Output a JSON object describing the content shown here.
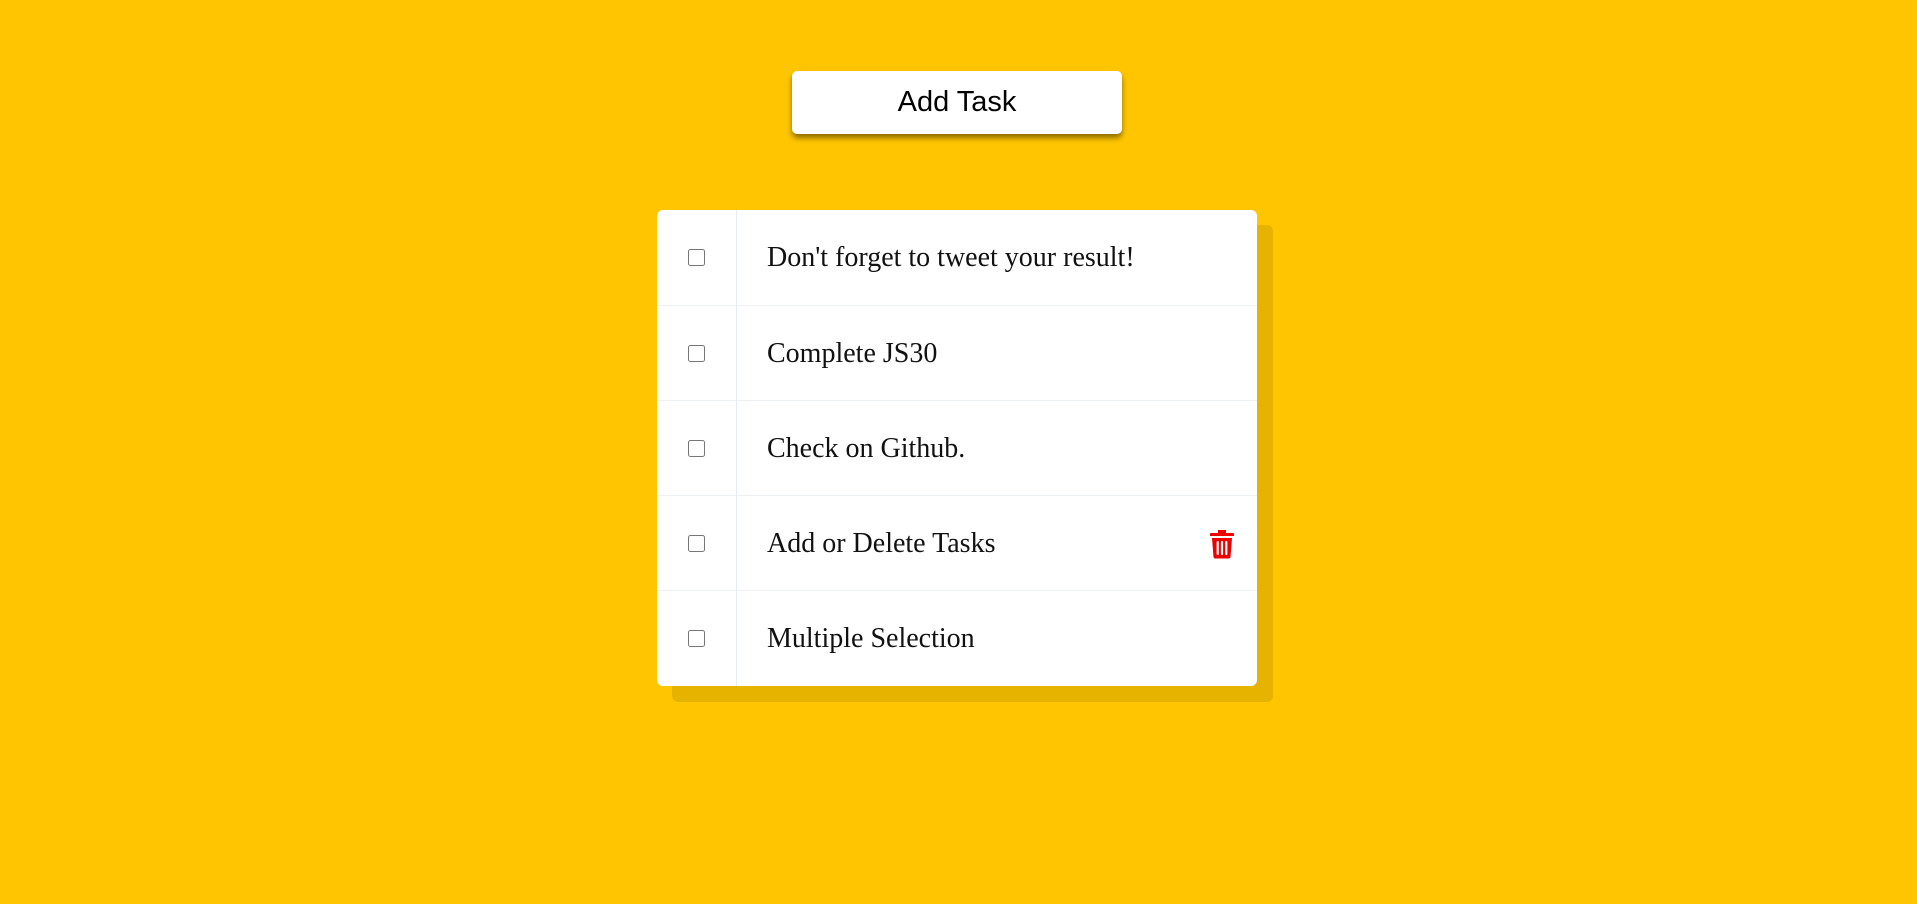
{
  "toolbar": {
    "add_label": "Add Task"
  },
  "tasks": [
    {
      "text": "Don't forget to tweet your result!",
      "checked": false
    },
    {
      "text": "Complete JS30",
      "checked": false
    },
    {
      "text": "Check on Github.",
      "checked": false
    },
    {
      "text": "Add or Delete Tasks",
      "checked": false,
      "delete_icon": "trash-icon"
    },
    {
      "text": "Multiple Selection",
      "checked": false
    }
  ],
  "colors": {
    "background": "#ffc600",
    "shadow": "#e6b300",
    "delete": "#ee0000"
  }
}
